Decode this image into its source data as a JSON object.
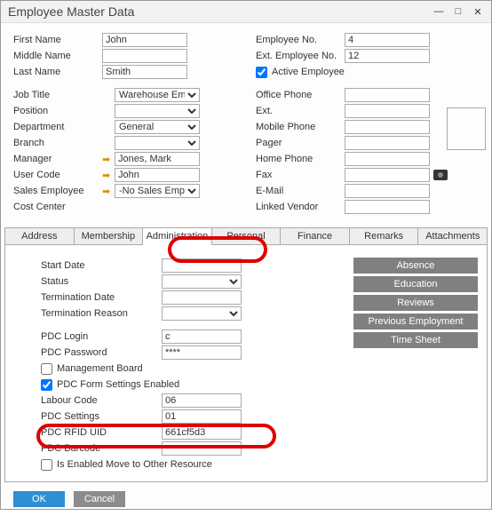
{
  "window": {
    "title": "Employee Master Data"
  },
  "top": {
    "firstName": {
      "label": "First Name",
      "value": "John"
    },
    "middleName": {
      "label": "Middle Name",
      "value": ""
    },
    "lastName": {
      "label": "Last Name",
      "value": "Smith"
    },
    "employeeNo": {
      "label": "Employee No.",
      "value": "4"
    },
    "extEmployeeNo": {
      "label": "Ext. Employee No.",
      "value": "12"
    },
    "activeEmployee": {
      "label": "Active Employee",
      "checked": true
    },
    "jobTitle": {
      "label": "Job Title",
      "value": "Warehouse Employee"
    },
    "position": {
      "label": "Position",
      "value": ""
    },
    "department": {
      "label": "Department",
      "value": "General"
    },
    "branch": {
      "label": "Branch",
      "value": ""
    },
    "manager": {
      "label": "Manager",
      "value": "Jones, Mark"
    },
    "userCode": {
      "label": "User Code",
      "value": "John"
    },
    "salesEmployee": {
      "label": "Sales Employee",
      "value": "-No Sales Employee-"
    },
    "costCenter": {
      "label": "Cost Center",
      "value": ""
    },
    "officePhone": {
      "label": "Office Phone",
      "value": ""
    },
    "ext": {
      "label": "Ext.",
      "value": ""
    },
    "mobilePhone": {
      "label": "Mobile Phone",
      "value": ""
    },
    "pager": {
      "label": "Pager",
      "value": ""
    },
    "homePhone": {
      "label": "Home Phone",
      "value": ""
    },
    "fax": {
      "label": "Fax",
      "value": ""
    },
    "email": {
      "label": "E-Mail",
      "value": ""
    },
    "linkedVendor": {
      "label": "Linked Vendor",
      "value": ""
    }
  },
  "tabs": {
    "address": "Address",
    "membership": "Membership",
    "administration": "Administration",
    "personal": "Personal",
    "finance": "Finance",
    "remarks": "Remarks",
    "attachments": "Attachments"
  },
  "admin": {
    "startDate": {
      "label": "Start Date",
      "value": ""
    },
    "status": {
      "label": "Status",
      "value": ""
    },
    "terminationDate": {
      "label": "Termination Date",
      "value": ""
    },
    "terminationReason": {
      "label": "Termination Reason",
      "value": ""
    },
    "pdcLogin": {
      "label": "PDC Login",
      "value": "c"
    },
    "pdcPassword": {
      "label": "PDC Password",
      "value": "****"
    },
    "managementBoard": {
      "label": "Management Board",
      "checked": false
    },
    "pdcFormSettings": {
      "label": "PDC Form Settings Enabled",
      "checked": true
    },
    "labourCode": {
      "label": "Labour Code",
      "value": "06"
    },
    "pdcSettings": {
      "label": "PDC Settings",
      "value": "01"
    },
    "pdcRfidUid": {
      "label": "PDC RFID UID",
      "value": "661cf5d3"
    },
    "pdcBarcode": {
      "label": "PDC Barcode",
      "value": ""
    },
    "moveOther": {
      "label": "Is Enabled Move to Other Resource",
      "checked": false
    }
  },
  "sideButtons": {
    "absence": "Absence",
    "education": "Education",
    "reviews": "Reviews",
    "prevEmployment": "Previous Employment",
    "timeSheet": "Time Sheet"
  },
  "buttons": {
    "ok": "OK",
    "cancel": "Cancel"
  }
}
